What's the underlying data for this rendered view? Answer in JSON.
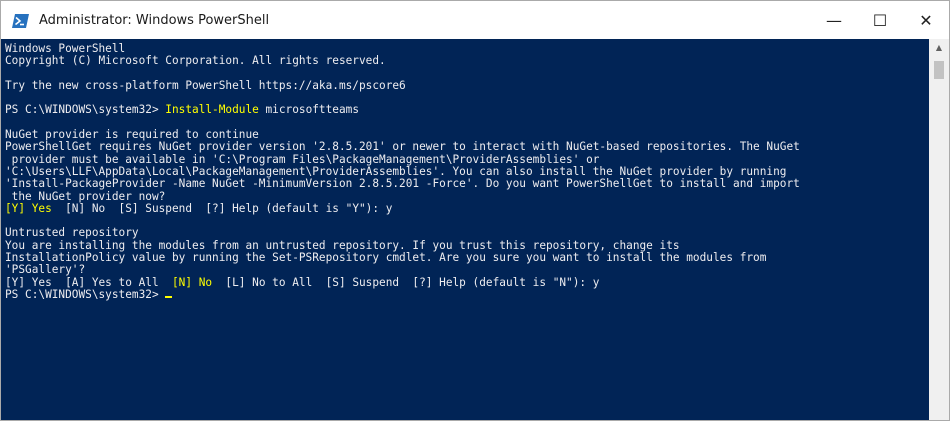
{
  "window": {
    "title": "Administrator: Windows PowerShell",
    "minimize_label": "—",
    "maximize_label": "☐",
    "close_label": "✕"
  },
  "console": {
    "lines": [
      {
        "text": "Windows PowerShell"
      },
      {
        "text": "Copyright (C) Microsoft Corporation. All rights reserved."
      },
      {
        "text": ""
      },
      {
        "text": "Try the new cross-platform PowerShell https://aka.ms/pscore6"
      },
      {
        "text": ""
      },
      {
        "prompt": "PS C:\\WINDOWS\\system32> ",
        "command": "Install-Module",
        "args": " microsoftteams"
      },
      {
        "text": ""
      },
      {
        "text": "NuGet provider is required to continue"
      },
      {
        "text": "PowerShellGet requires NuGet provider version '2.8.5.201' or newer to interact with NuGet-based repositories. The NuGet"
      },
      {
        "text": " provider must be available in 'C:\\Program Files\\PackageManagement\\ProviderAssemblies' or"
      },
      {
        "text": "'C:\\Users\\LLF\\AppData\\Local\\PackageManagement\\ProviderAssemblies'. You can also install the NuGet provider by running"
      },
      {
        "text": "'Install-PackageProvider -Name NuGet -MinimumVersion 2.8.5.201 -Force'. Do you want PowerShellGet to install and import"
      },
      {
        "text": " the NuGet provider now?"
      },
      {
        "highlight": "[Y] Yes",
        "rest": "  [N] No  [S] Suspend  [?] Help (default is \"Y\"): y"
      },
      {
        "text": ""
      },
      {
        "text": "Untrusted repository"
      },
      {
        "text": "You are installing the modules from an untrusted repository. If you trust this repository, change its"
      },
      {
        "text": "InstallationPolicy value by running the Set-PSRepository cmdlet. Are you sure you want to install the modules from"
      },
      {
        "text": "'PSGallery'?"
      },
      {
        "before": "[Y] Yes  [A] Yes to All  ",
        "highlight": "[N] No",
        "rest": "  [L] No to All  [S] Suspend  [?] Help (default is \"N\"): y"
      },
      {
        "prompt": "PS C:\\WINDOWS\\system32> ",
        "cursor": true
      }
    ]
  }
}
